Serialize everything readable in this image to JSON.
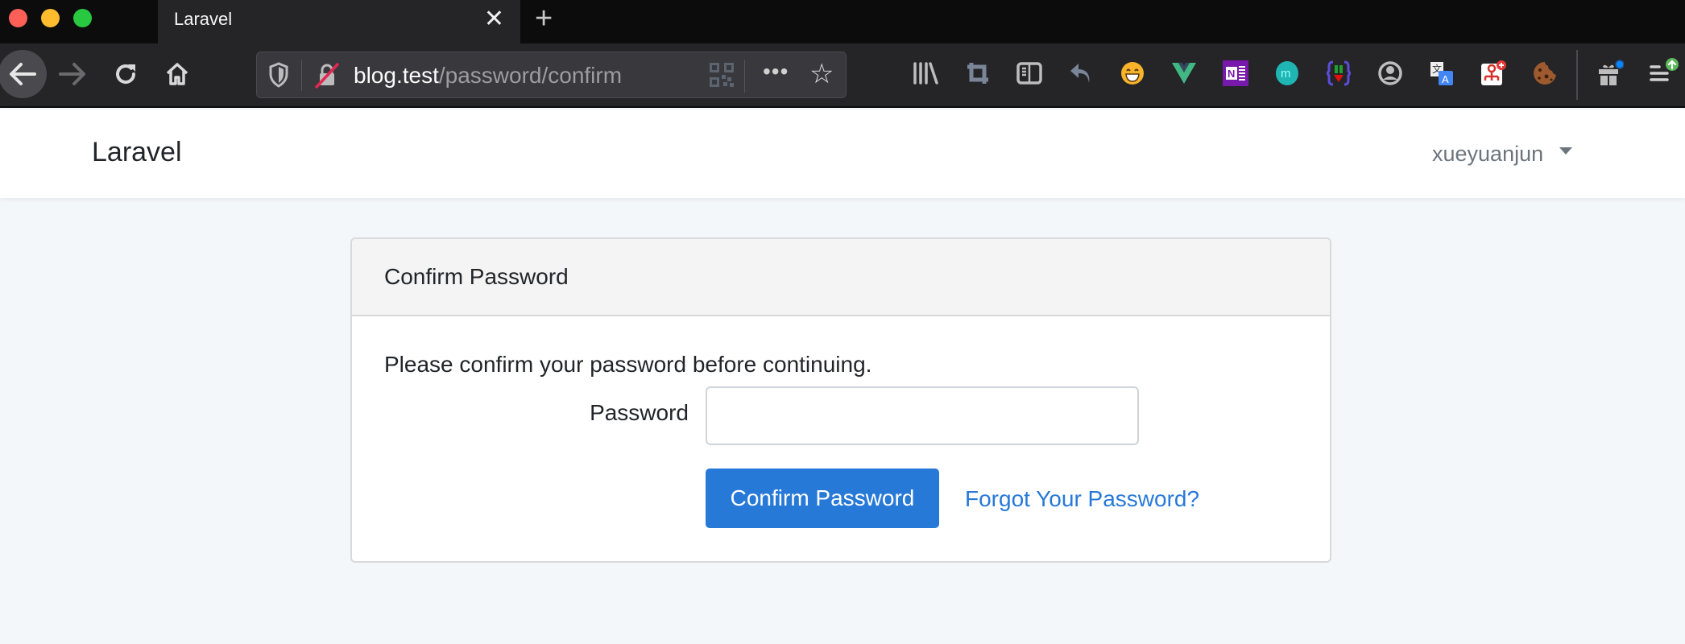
{
  "browser": {
    "tab": {
      "title": "Laravel",
      "close_glyph": "✕"
    },
    "new_tab_glyph": "+",
    "url": {
      "host": "blog.test",
      "path": "/password/confirm"
    },
    "nav": {
      "back_icon": "←",
      "forward_icon": "→",
      "reload_icon": "↻",
      "home_icon": "⌂"
    },
    "url_more_glyph": "•••",
    "star_glyph": "☆",
    "extensions": [
      "library-icon",
      "crop-screenshot-icon",
      "reader-sidebar-icon",
      "undo-close-tab-icon",
      "emoji-extension-icon",
      "vue-devtools-icon",
      "onenote-clipper-icon",
      "mercury-reader-icon",
      "json-viewer-icon",
      "account-icon",
      "google-translate-icon",
      "sitemap-extension-icon",
      "cookie-editor-icon",
      "whats-new-gift-icon",
      "app-menu-icon"
    ]
  },
  "navbar": {
    "brand": "Laravel",
    "user": "xueyuanjun"
  },
  "card": {
    "title": "Confirm Password",
    "lead": "Please confirm your password before continuing.",
    "password_label": "Password",
    "password_value": "",
    "submit_label": "Confirm Password",
    "forgot_link": "Forgot Your Password?"
  },
  "colors": {
    "primary": "#2779d8",
    "page_bg": "#f4f7fa",
    "chrome_bg": "#252528"
  }
}
